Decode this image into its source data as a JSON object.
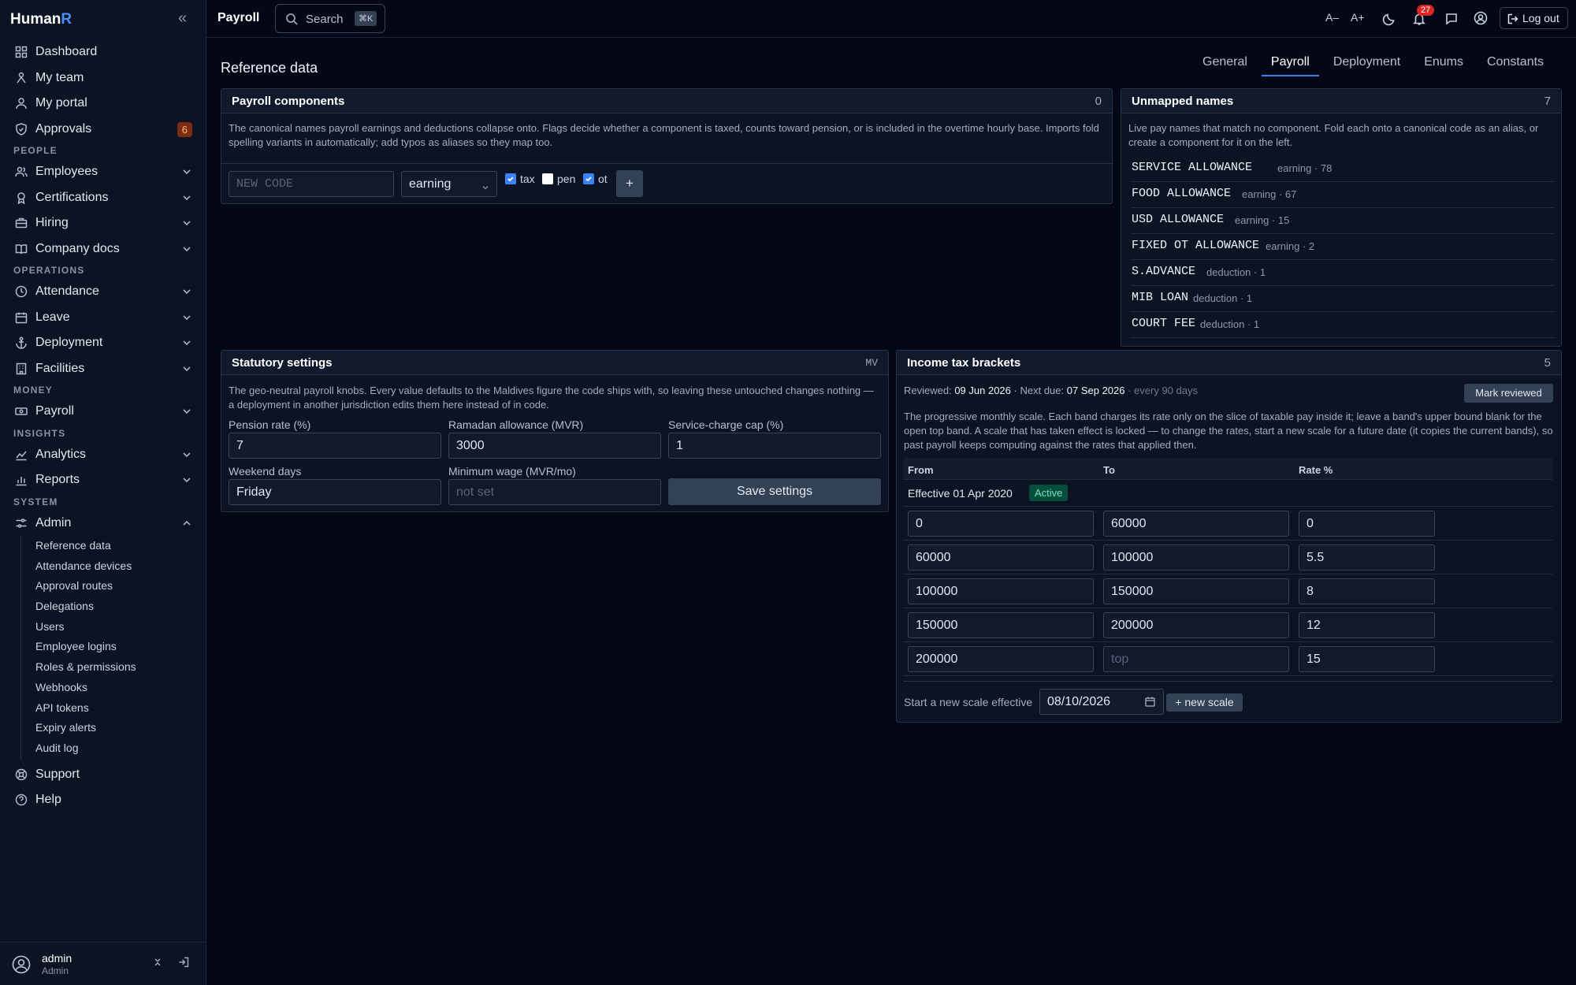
{
  "app": {
    "logo_main": "Human",
    "logo_accent": "R",
    "collapse_icon": "«"
  },
  "sidebar": {
    "items": [
      {
        "label": "Dashboard"
      },
      {
        "label": "My team"
      },
      {
        "label": "My portal"
      },
      {
        "label": "Approvals",
        "badge": "6"
      }
    ],
    "section_people": "PEOPLE",
    "people": [
      {
        "label": "Employees"
      },
      {
        "label": "Certifications"
      },
      {
        "label": "Hiring"
      },
      {
        "label": "Company docs"
      }
    ],
    "section_operations": "OPERATIONS",
    "operations": [
      {
        "label": "Attendance"
      },
      {
        "label": "Leave"
      },
      {
        "label": "Deployment"
      },
      {
        "label": "Facilities"
      }
    ],
    "section_money": "MONEY",
    "money": [
      {
        "label": "Payroll"
      }
    ],
    "section_insights": "INSIGHTS",
    "insights": [
      {
        "label": "Analytics"
      },
      {
        "label": "Reports"
      }
    ],
    "section_system": "SYSTEM",
    "admin_label": "Admin",
    "admin_sub": [
      "Reference data",
      "Attendance devices",
      "Approval routes",
      "Delegations",
      "Users",
      "Employee logins",
      "Roles & permissions",
      "Webhooks",
      "API tokens",
      "Expiry alerts",
      "Audit log"
    ],
    "support_label": "Support",
    "help_label": "Help",
    "user_name": "admin",
    "user_role": "Admin"
  },
  "topbar": {
    "title": "Payroll",
    "search_label": "Search",
    "search_kbd": "⌘K",
    "font_smaller": "A–",
    "font_larger": "A+",
    "notif_count": "27",
    "logout_label": "Log out"
  },
  "page": {
    "title": "Reference data"
  },
  "tabs": [
    {
      "label": "General"
    },
    {
      "label": "Payroll",
      "active": true
    },
    {
      "label": "Deployment"
    },
    {
      "label": "Enums"
    },
    {
      "label": "Constants"
    }
  ],
  "payroll_components": {
    "title": "Payroll components",
    "count": "0",
    "description": "The canonical names payroll earnings and deductions collapse onto. Flags decide whether a component is taxed, counts toward pension, or is included in the overtime hourly base. Imports fold spelling variants in automatically; add typos as aliases so they map too.",
    "new_code_placeholder": "NEW CODE",
    "type_value": "earning",
    "flag_tax": "tax",
    "flag_pen": "pen",
    "flag_ot": "ot",
    "tax_checked": true,
    "pen_checked": false,
    "ot_checked": true,
    "add_label": "+"
  },
  "unmapped": {
    "title": "Unmapped names",
    "count": "7",
    "description": "Live pay names that match no component. Fold each onto a canonical code as an alias, or create a component for it on the left.",
    "rows": [
      {
        "name": "SERVICE ALLOWANCE",
        "meta": "earning · 78"
      },
      {
        "name": "FOOD ALLOWANCE",
        "meta": "earning · 67"
      },
      {
        "name": "USD ALLOWANCE",
        "meta": "earning · 15"
      },
      {
        "name": "FIXED OT ALLOWANCE",
        "meta": "earning · 2"
      },
      {
        "name": "S.ADVANCE",
        "meta": "deduction · 1"
      },
      {
        "name": "MIB LOAN",
        "meta": "deduction · 1"
      },
      {
        "name": "COURT FEE",
        "meta": "deduction · 1"
      }
    ]
  },
  "statutory": {
    "title": "Statutory settings",
    "code": "MV",
    "description": "The geo-neutral payroll knobs. Every value defaults to the Maldives figure the code ships with, so leaving these untouched changes nothing — a deployment in another jurisdiction edits them here instead of in code.",
    "pension_label": "Pension rate (%)",
    "pension_value": "7",
    "ramadan_label": "Ramadan allowance (MVR)",
    "ramadan_value": "3000",
    "service_cap_label": "Service-charge cap (%)",
    "service_cap_value": "1",
    "weekend_label": "Weekend days",
    "weekend_value": "Friday",
    "min_wage_label": "Minimum wage (MVR/mo)",
    "min_wage_placeholder": "not set",
    "save_label": "Save settings"
  },
  "tax_brackets": {
    "title": "Income tax brackets",
    "count": "5",
    "reviewed_label": "Reviewed:",
    "reviewed_date": "09 Jun 2026",
    "next_due_label": "· Next due:",
    "next_due_date": "07 Sep 2026",
    "interval": "· every 90 days",
    "mark_reviewed": "Mark reviewed",
    "description": "The progressive monthly scale. Each band charges its rate only on the slice of taxable pay inside it; leave a band's upper bound blank for the open top band. A scale that has taken effect is locked — to change the rates, start a new scale for a future date (it copies the current bands), so past payroll keeps computing against the rates that applied then.",
    "col_from": "From",
    "col_to": "To",
    "col_rate": "Rate %",
    "effective_label": "Effective 01 Apr 2020",
    "active_label": "Active",
    "bands": [
      {
        "from": "0",
        "to": "60000",
        "rate": "0"
      },
      {
        "from": "60000",
        "to": "100000",
        "rate": "5.5"
      },
      {
        "from": "100000",
        "to": "150000",
        "rate": "8"
      },
      {
        "from": "150000",
        "to": "200000",
        "rate": "12"
      },
      {
        "from": "200000",
        "to": "",
        "rate": "15"
      }
    ],
    "top_placeholder": "top",
    "new_scale_label": "Start a new scale effective",
    "new_scale_date": "08/10/2026",
    "new_scale_button": "+ new scale"
  }
}
